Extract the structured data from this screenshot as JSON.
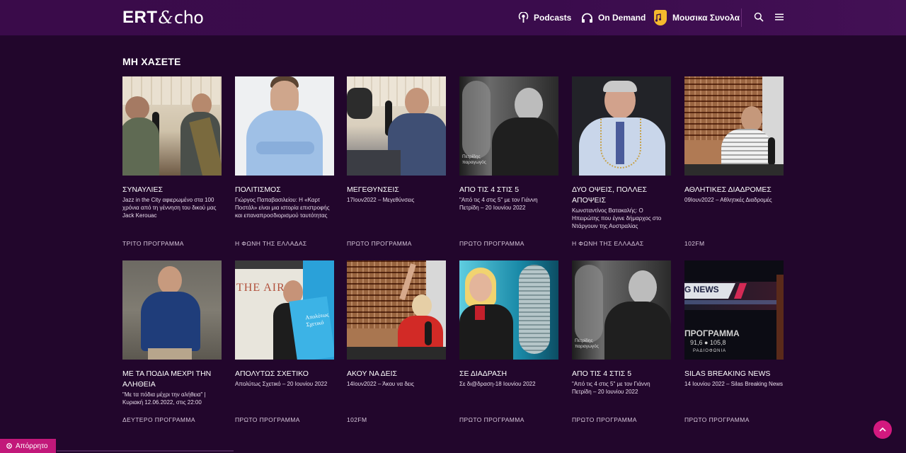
{
  "header": {
    "logo_ert": "ERT",
    "logo_amp": "&",
    "logo_echo": "cho",
    "nav": [
      {
        "label": "Podcasts",
        "icon": "podcast-icon"
      },
      {
        "label": "On Demand",
        "icon": "headphones-icon"
      },
      {
        "label": "Μουσικα Συνολα",
        "icon": "music-badge-icon"
      }
    ],
    "search_icon": "search-icon",
    "menu_icon": "hamburger-icon"
  },
  "section": {
    "title": "ΜΗ ΧΑΣΕΤΕ"
  },
  "cards": [
    {
      "title": "ΣΥΝΑΥΛΙΕΣ",
      "desc": "Jazz in the City αφιερωμένο στα 100 χρόνια από τη γέννηση του δικού μας Jack Kerouac",
      "tag": "ΤΡΙΤΟ ΠΡΟΓΡΑΜΜΑ"
    },
    {
      "title": "ΠΟΛΙΤΙΣΜΟΣ",
      "desc": "Γιώργος Παπαβασιλείου: Η «Καρτ Ποστάλ» είναι μια ιστορία επιστροφής και επαναπροσδιορισμού ταυτότητας",
      "tag": "Η ΦΩΝΗ ΤΗΣ ΕΛΛΑΔΑΣ"
    },
    {
      "title": "ΜΕΓΕΘΥΝΣΕΙΣ",
      "desc": "17Ιουν2022 – Μεγεθύνσεις",
      "tag": "ΠΡΩΤΟ ΠΡΟΓΡΑΜΜΑ"
    },
    {
      "title": "ΑΠΟ ΤΙΣ 4 ΣΤΙΣ 5",
      "desc": "\"Από τις 4 στις 5\" με τον Γιάννη Πετρίδη – 20 Ιουνίου 2022",
      "tag": "ΠΡΩΤΟ ΠΡΟΓΡΑΜΜΑ"
    },
    {
      "title": "ΔΥΟ ΟΨΕΙΣ, ΠΟΛΛΕΣ ΑΠΟΨΕΙΣ",
      "desc": "Κωνσταντίνος Βατακαλής: Ο Ηπειρώτης που έγινε δήμαρχος στο Ντάργουιν της Αυστραλίας",
      "tag": "Η ΦΩΝΗ ΤΗΣ ΕΛΛΑΔΑΣ"
    },
    {
      "title": "ΑΘΛΗΤΙΚΕΣ ΔΙΑΔΡΟΜΕΣ",
      "desc": "09Ιουν2022 – Αθλητικές Διαδρομές",
      "tag": "102FM"
    },
    {
      "title": "ΜΕ ΤΑ ΠΟΔΙΑ ΜΕΧΡΙ ΤΗΝ ΑΛΗΘΕΙΑ",
      "desc": "\"Με τα πόδια μέχρι την αλήθεια\" | Κυριακή 12.06.2022, στις 22:00",
      "tag": "ΔΕΥΤΕΡΟ ΠΡΟΓΡΑΜΜΑ"
    },
    {
      "title": "ΑΠΟΛΥΤΩΣ ΣΧΕΤΙΚΟ",
      "desc": "Απολύτως Σχετικό – 20 Ιουνίου 2022",
      "tag": "ΠΡΩΤΟ ΠΡΟΓΡΑΜΜΑ"
    },
    {
      "title": "ΑΚΟΥ ΝΑ ΔΕΙΣ",
      "desc": "14Ιουν2022 – Άκου να δεις",
      "tag": "102FM"
    },
    {
      "title": "ΣΕ ΔΙΑΔΡΑΣΗ",
      "desc": "Σε δι@δραση-18 Ιουνίου 2022",
      "tag": "ΠΡΩΤΟ ΠΡΟΓΡΑΜΜΑ"
    },
    {
      "title": "ΑΠΟ ΤΙΣ 4 ΣΤΙΣ 5",
      "desc": "\"Από τις 4 στις 5\" με τον Γιάννη Πετρίδη – 20 Ιουνίου 2022",
      "tag": "ΠΡΩΤΟ ΠΡΟΓΡΑΜΜΑ"
    },
    {
      "title": "SILAS BREAKING NEWS",
      "desc": "14 Ιουνίου 2022 – Silas Breaking News",
      "tag": "ΠΡΩΤΟ ΠΡΟΓΡΑΜΜΑ"
    }
  ],
  "thumb_text": {
    "petridis_caption_1": "Πετρίδης",
    "petridis_caption_2": "παραγωγός",
    "the_air": "THE AIR",
    "apolytos": "Απολύτως Σχετικό",
    "g_news": "G NEWS",
    "programma": "ΠΡΟΓΡΑΜΜΑ",
    "freqs": "91,6 ● 105,8",
    "radiofonia": "ΡΑΔΙΟΦΩΝΙΑ"
  },
  "footer": {
    "privacy_label": "Απόρρητο"
  }
}
